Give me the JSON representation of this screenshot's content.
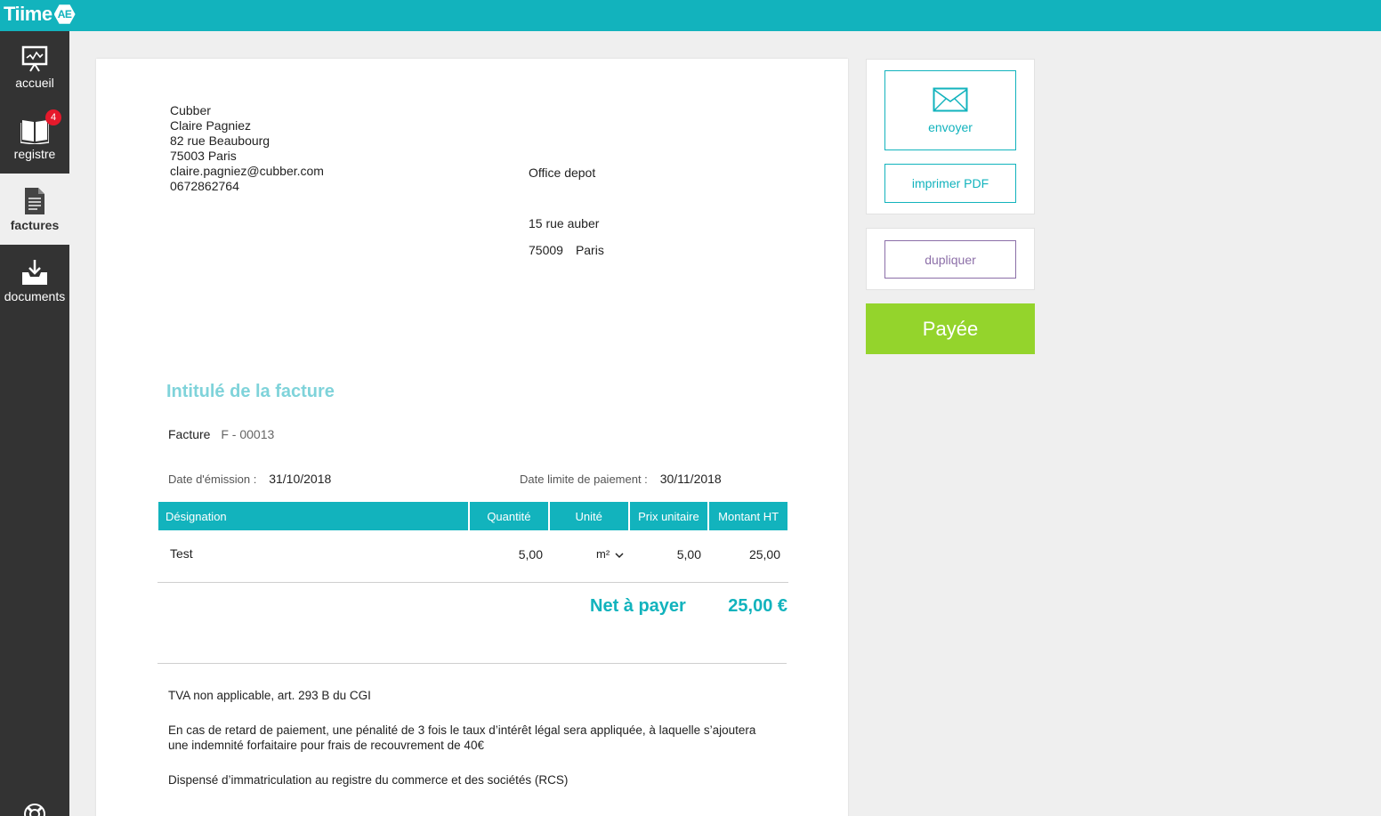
{
  "app": {
    "logo_text": "Tiime",
    "logo_badge": "AE"
  },
  "sidebar": {
    "items": [
      {
        "label": "accueil",
        "icon": "presentation-chart-icon"
      },
      {
        "label": "registre",
        "icon": "book-icon",
        "badge": "4"
      },
      {
        "label": "factures",
        "icon": "document-icon",
        "active": true
      },
      {
        "label": "documents",
        "icon": "inbox-download-icon"
      }
    ],
    "help_icon": "lifebuoy-icon"
  },
  "invoice": {
    "sender": {
      "company": "Cubber",
      "name": "Claire Pagniez",
      "street": "82 rue Beaubourg",
      "city": "75003 Paris",
      "email": "claire.pagniez@cubber.com",
      "phone": "0672862764"
    },
    "recipient": {
      "name": "Office depot",
      "street": "15 rue auber",
      "postal_code": "75009",
      "city": "Paris"
    },
    "title_placeholder": "Intitulé de la facture",
    "facture_label": "Facture",
    "facture_number": "F - 00013",
    "emission_label": "Date d'émission :",
    "emission_date": "31/10/2018",
    "due_label": "Date limite de paiement :",
    "due_date": "30/11/2018",
    "table": {
      "headers": [
        "Désignation",
        "Quantité",
        "Unité",
        "Prix unitaire",
        "Montant HT"
      ],
      "rows": [
        {
          "designation": "Test",
          "quantite": "5,00",
          "unite": "m²",
          "prix": "5,00",
          "montant": "25,00"
        }
      ]
    },
    "net_label": "Net à payer",
    "net_value": "25,00 €",
    "legal": [
      "TVA non applicable, art. 293 B du CGI",
      "En cas de retard de paiement, une pénalité de 3 fois le taux d’intérêt légal sera appliquée, à laquelle s’ajoutera une indemnité forfaitaire pour frais de recouvrement de 40€",
      "Dispensé d’immatriculation au registre du commerce et des sociétés (RCS)"
    ]
  },
  "actions": {
    "send_label": "envoyer",
    "pdf_label": "imprimer PDF",
    "duplicate_label": "dupliquer",
    "paid_label": "Payée"
  },
  "colors": {
    "brand": "#12b3bd",
    "sidebar": "#333333",
    "paid": "#94d42c",
    "duplicate": "#8c6fa8",
    "badge": "#e5192b"
  }
}
